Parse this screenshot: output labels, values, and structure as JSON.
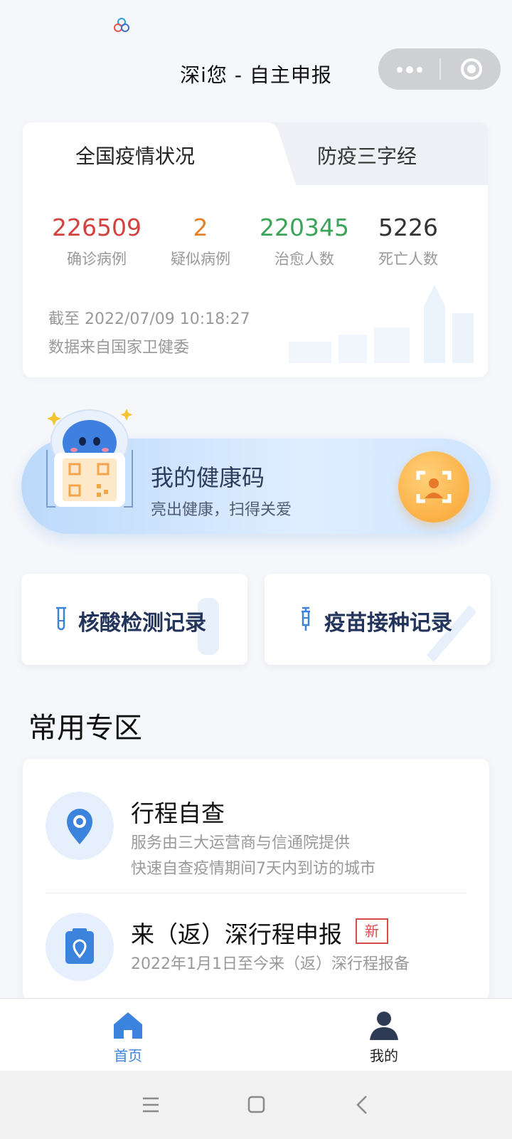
{
  "header": {
    "title": "深i您 - 自主申报",
    "icons": [
      "app-logo-icon",
      "more-icon",
      "close-capsule-icon"
    ]
  },
  "stats_card": {
    "tabs": [
      "全国疫情状况",
      "防疫三字经"
    ],
    "stats": [
      {
        "value": "226509",
        "label": "确诊病例",
        "color": "#d2433f"
      },
      {
        "value": "2",
        "label": "疑似病例",
        "color": "#e4812b"
      },
      {
        "value": "220345",
        "label": "治愈人数",
        "color": "#3aa457"
      },
      {
        "value": "5226",
        "label": "死亡人数",
        "color": "#333333"
      }
    ],
    "update_time": "截至 2022/07/09 10:18:27",
    "source": "数据来自国家卫健委"
  },
  "health_code": {
    "title": "我的健康码",
    "subtitle": "亮出健康，扫得关爱",
    "icons": [
      "mascot-icon",
      "qr-code-icon",
      "face-scan-icon"
    ]
  },
  "records": [
    {
      "label": "核酸检测记录",
      "icon": "test-tube-icon"
    },
    {
      "label": "疫苗接种记录",
      "icon": "syringe-icon"
    }
  ],
  "section_title": "常用专区",
  "common_items": [
    {
      "title": "行程自查",
      "lines": [
        "服务由三大运营商与信通院提供",
        "快速自查疫情期间7天内到访的城市"
      ],
      "icon": "location-pin-icon"
    },
    {
      "title": "来（返）深行程申报",
      "badge": "新",
      "lines": [
        "2022年1月1日至今来（返）深行程报备"
      ],
      "icon": "clipboard-location-icon"
    }
  ],
  "tabbar": {
    "items": [
      {
        "label": "首页",
        "icon": "home-icon",
        "active": true
      },
      {
        "label": "我的",
        "icon": "user-icon",
        "active": false
      }
    ]
  },
  "colors": {
    "accent": "#3b83dc",
    "navy": "#22335c",
    "orange": "#fbb045"
  }
}
